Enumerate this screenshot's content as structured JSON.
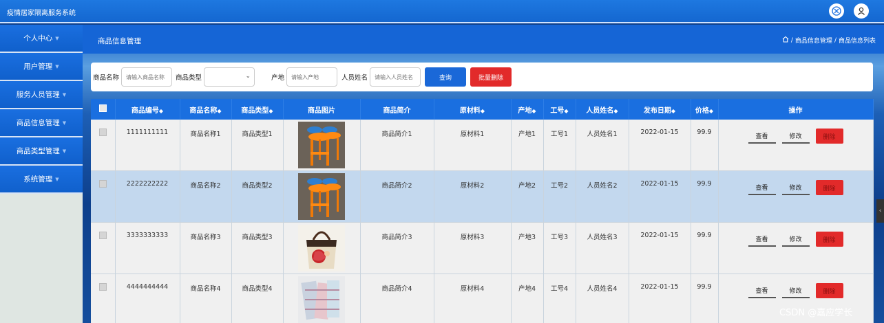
{
  "app": {
    "title": "疫情居家隔离服务系统"
  },
  "sidebar": {
    "items": [
      {
        "label": "个人中心"
      },
      {
        "label": "用户管理"
      },
      {
        "label": "服务人员管理"
      },
      {
        "label": "商品信息管理"
      },
      {
        "label": "商品类型管理"
      },
      {
        "label": "系统管理"
      }
    ]
  },
  "header": {
    "page_title": "商品信息管理",
    "breadcrumb": [
      "商品信息管理",
      "商品信息列表"
    ],
    "separator": "/"
  },
  "search": {
    "name_label": "商品名称",
    "name_placeholder": "请输入商品名称",
    "type_label": "商品类型",
    "type_value": "",
    "origin_label": "产地",
    "origin_placeholder": "请输入产地",
    "staff_label": "人员姓名",
    "staff_placeholder": "请输入人员姓名",
    "query_label": "查询",
    "batch_delete_label": "批量删除"
  },
  "table": {
    "columns": [
      "商品编号",
      "商品名称",
      "商品类型",
      "商品图片",
      "商品简介",
      "原材料",
      "产地",
      "工号",
      "人员姓名",
      "发布日期",
      "价格",
      "操作"
    ],
    "sort_glyph": "◆",
    "actions": {
      "view": "查看",
      "edit": "修改",
      "delete": "删除"
    },
    "rows": [
      {
        "id": "1111111111",
        "name": "商品名称1",
        "type": "商品类型1",
        "image": "stool",
        "intro": "商品简介1",
        "material": "原材料1",
        "origin": "产地1",
        "job_no": "工号1",
        "staff": "人员姓名1",
        "date": "2022-01-15",
        "price": "99.9"
      },
      {
        "id": "2222222222",
        "name": "商品名称2",
        "type": "商品类型2",
        "image": "stool",
        "intro": "商品简介2",
        "material": "原材料2",
        "origin": "产地2",
        "job_no": "工号2",
        "staff": "人员姓名2",
        "date": "2022-01-15",
        "price": "99.9"
      },
      {
        "id": "3333333333",
        "name": "商品名称3",
        "type": "商品类型3",
        "image": "handbag",
        "intro": "商品简介3",
        "material": "原材料3",
        "origin": "产地3",
        "job_no": "工号3",
        "staff": "人员姓名3",
        "date": "2022-01-15",
        "price": "99.9"
      },
      {
        "id": "4444444444",
        "name": "商品名称4",
        "type": "商品类型4",
        "image": "fabric-boxes",
        "intro": "商品简介4",
        "material": "原材料4",
        "origin": "产地4",
        "job_no": "工号4",
        "staff": "人员姓名4",
        "date": "2022-01-15",
        "price": "99.9"
      }
    ]
  },
  "watermark": "CSDN @嘉应学长",
  "colors": {
    "primary": "#1a6fe0",
    "danger": "#e22a2a",
    "highlight_row": "#c3d8ee"
  }
}
